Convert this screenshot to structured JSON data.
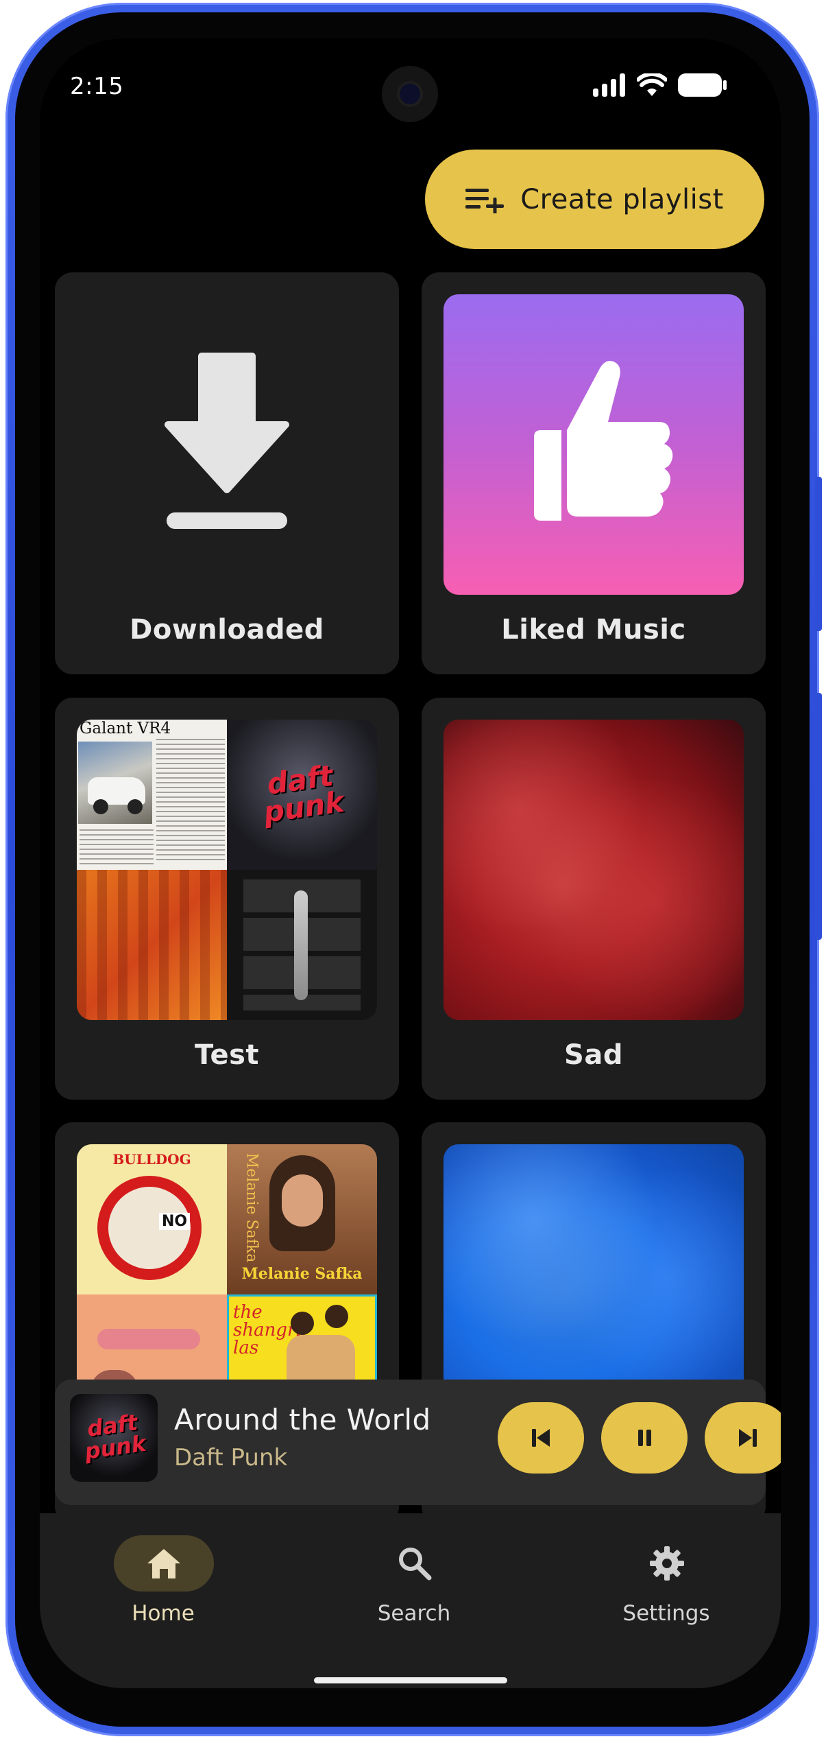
{
  "status_bar": {
    "time": "2:15"
  },
  "header": {
    "create_playlist_label": "Create playlist"
  },
  "playlists": [
    {
      "name": "Downloaded",
      "art": "download-icon"
    },
    {
      "name": "Liked Music",
      "art": "thumbs-up-icon"
    },
    {
      "name": "Test",
      "art": "album-collage"
    },
    {
      "name": "Sad",
      "art": "red-cloud-image"
    },
    {
      "name": "",
      "art": "album-collage"
    },
    {
      "name": "",
      "art": "blue-cloud-image"
    }
  ],
  "collage_texts": {
    "galant": "Galant VR4",
    "daft_punk": "daft punk",
    "bulldog": "BULLDOG",
    "no": "NO",
    "melanie": "Melanie Safka",
    "melanie_side": "Melanie Safka",
    "shangri": "the shangri las"
  },
  "now_playing": {
    "title": "Around the World",
    "artist": "Daft Punk",
    "art_text": "daft punk"
  },
  "nav": {
    "home": "Home",
    "search": "Search",
    "settings": "Settings"
  },
  "colors": {
    "accent": "#e6c34a",
    "background": "#000000",
    "surface": "#1e1e1e",
    "player": "#2d2d2d"
  }
}
